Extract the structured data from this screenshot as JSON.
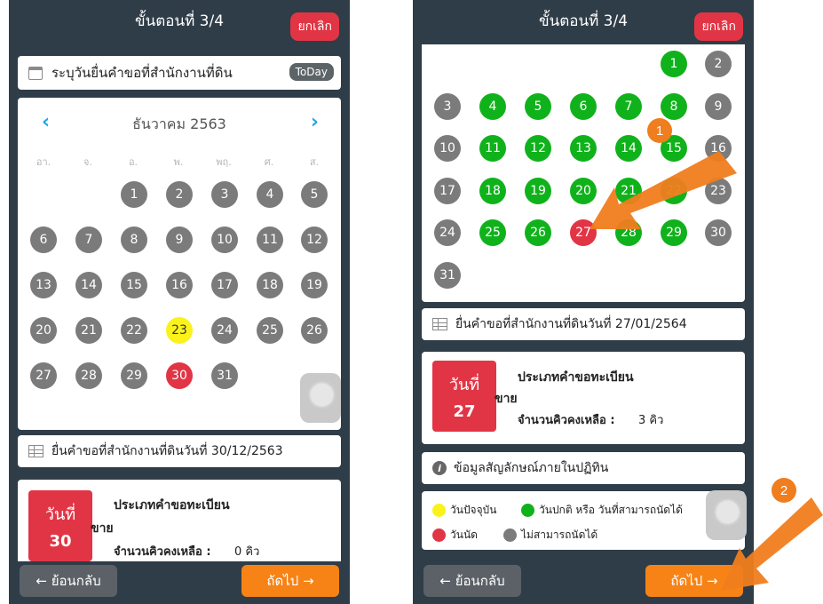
{
  "header": {
    "title": "ขั้นตอนที่ 3/4",
    "cancel_label": "ยกเลิก"
  },
  "left": {
    "date_label": "ระบุวันยื่นคำขอที่สำนักงานที่ดิน",
    "today_label": "ToDay",
    "month_label": "ธันวาคม 2563",
    "prev_icon": "‹",
    "next_icon": "›",
    "weekdays": [
      "อา.",
      "จ.",
      "อ.",
      "พ.",
      "พฤ.",
      "ศ.",
      "ส."
    ],
    "filed_text": "ยื่นคำขอที่สำนักงานที่ดินวันที่ 30/12/2563",
    "appt": {
      "day_label": "วันที่",
      "day_number": "30",
      "type_label": "ประเภทคำขอทะเบียน",
      "type_value": "ขาย",
      "queue_label": "จำนวนคิวคงเหลือ :",
      "queue_value": "0 คิว"
    }
  },
  "right": {
    "filed_text": "ยื่นคำขอที่สำนักงานที่ดินวันที่ 27/01/2564",
    "appt": {
      "day_label": "วันที่",
      "day_number": "27",
      "type_label": "ประเภทคำขอทะเบียน",
      "type_value": "ขาย",
      "queue_label": "จำนวนคิวคงเหลือ :",
      "queue_value": "3 คิว"
    },
    "info_label": "ข้อมูลสัญลักษณ์ภายในปฏิทิน",
    "legend": {
      "today": "วันปัจจุบัน",
      "available": "วันปกติ หรือ วันที่สามารถนัดได้",
      "selected": "วันนัด",
      "unavailable": "ไม่สามารถนัดได้"
    }
  },
  "footer": {
    "back_label": "← ย้อนกลับ",
    "next_label": "ถัดไป →"
  },
  "annotations": {
    "step1": "1",
    "step2": "2"
  },
  "colors": {
    "available": "#10b21b",
    "unavailable": "#7b7b7b",
    "today": "#fbf21b",
    "selected": "#e13545",
    "accent": "#f78316",
    "chevron": "#21a5e8"
  },
  "calendar_left": [
    {
      "label": "1",
      "status": "unavailable"
    },
    {
      "label": "2",
      "status": "unavailable"
    },
    {
      "label": "3",
      "status": "unavailable"
    },
    {
      "label": "4",
      "status": "unavailable"
    },
    {
      "label": "5",
      "status": "unavailable"
    },
    {
      "label": "6",
      "status": "unavailable"
    },
    {
      "label": "7",
      "status": "unavailable"
    },
    {
      "label": "8",
      "status": "unavailable"
    },
    {
      "label": "9",
      "status": "unavailable"
    },
    {
      "label": "10",
      "status": "unavailable"
    },
    {
      "label": "11",
      "status": "unavailable"
    },
    {
      "label": "12",
      "status": "unavailable"
    },
    {
      "label": "13",
      "status": "unavailable"
    },
    {
      "label": "14",
      "status": "unavailable"
    },
    {
      "label": "15",
      "status": "unavailable"
    },
    {
      "label": "16",
      "status": "unavailable"
    },
    {
      "label": "17",
      "status": "unavailable"
    },
    {
      "label": "18",
      "status": "unavailable"
    },
    {
      "label": "19",
      "status": "unavailable"
    },
    {
      "label": "20",
      "status": "unavailable"
    },
    {
      "label": "21",
      "status": "unavailable"
    },
    {
      "label": "22",
      "status": "unavailable"
    },
    {
      "label": "23",
      "status": "today"
    },
    {
      "label": "24",
      "status": "unavailable"
    },
    {
      "label": "25",
      "status": "unavailable"
    },
    {
      "label": "26",
      "status": "unavailable"
    },
    {
      "label": "27",
      "status": "unavailable"
    },
    {
      "label": "28",
      "status": "unavailable"
    },
    {
      "label": "29",
      "status": "unavailable"
    },
    {
      "label": "30",
      "status": "selected"
    },
    {
      "label": "31",
      "status": "unavailable"
    }
  ],
  "calendar_right": [
    {
      "label": "1",
      "status": "available"
    },
    {
      "label": "2",
      "status": "unavailable"
    },
    {
      "label": "3",
      "status": "unavailable"
    },
    {
      "label": "4",
      "status": "available"
    },
    {
      "label": "5",
      "status": "available"
    },
    {
      "label": "6",
      "status": "available"
    },
    {
      "label": "7",
      "status": "available"
    },
    {
      "label": "8",
      "status": "available"
    },
    {
      "label": "9",
      "status": "unavailable"
    },
    {
      "label": "10",
      "status": "unavailable"
    },
    {
      "label": "11",
      "status": "available"
    },
    {
      "label": "12",
      "status": "available"
    },
    {
      "label": "13",
      "status": "available"
    },
    {
      "label": "14",
      "status": "available"
    },
    {
      "label": "15",
      "status": "available"
    },
    {
      "label": "16",
      "status": "unavailable"
    },
    {
      "label": "17",
      "status": "unavailable"
    },
    {
      "label": "18",
      "status": "available"
    },
    {
      "label": "19",
      "status": "available"
    },
    {
      "label": "20",
      "status": "available"
    },
    {
      "label": "21",
      "status": "available"
    },
    {
      "label": "22",
      "status": "available"
    },
    {
      "label": "23",
      "status": "unavailable"
    },
    {
      "label": "24",
      "status": "unavailable"
    },
    {
      "label": "25",
      "status": "available"
    },
    {
      "label": "26",
      "status": "available"
    },
    {
      "label": "27",
      "status": "selected"
    },
    {
      "label": "28",
      "status": "available"
    },
    {
      "label": "29",
      "status": "available"
    },
    {
      "label": "30",
      "status": "unavailable"
    },
    {
      "label": "31",
      "status": "unavailable"
    }
  ]
}
